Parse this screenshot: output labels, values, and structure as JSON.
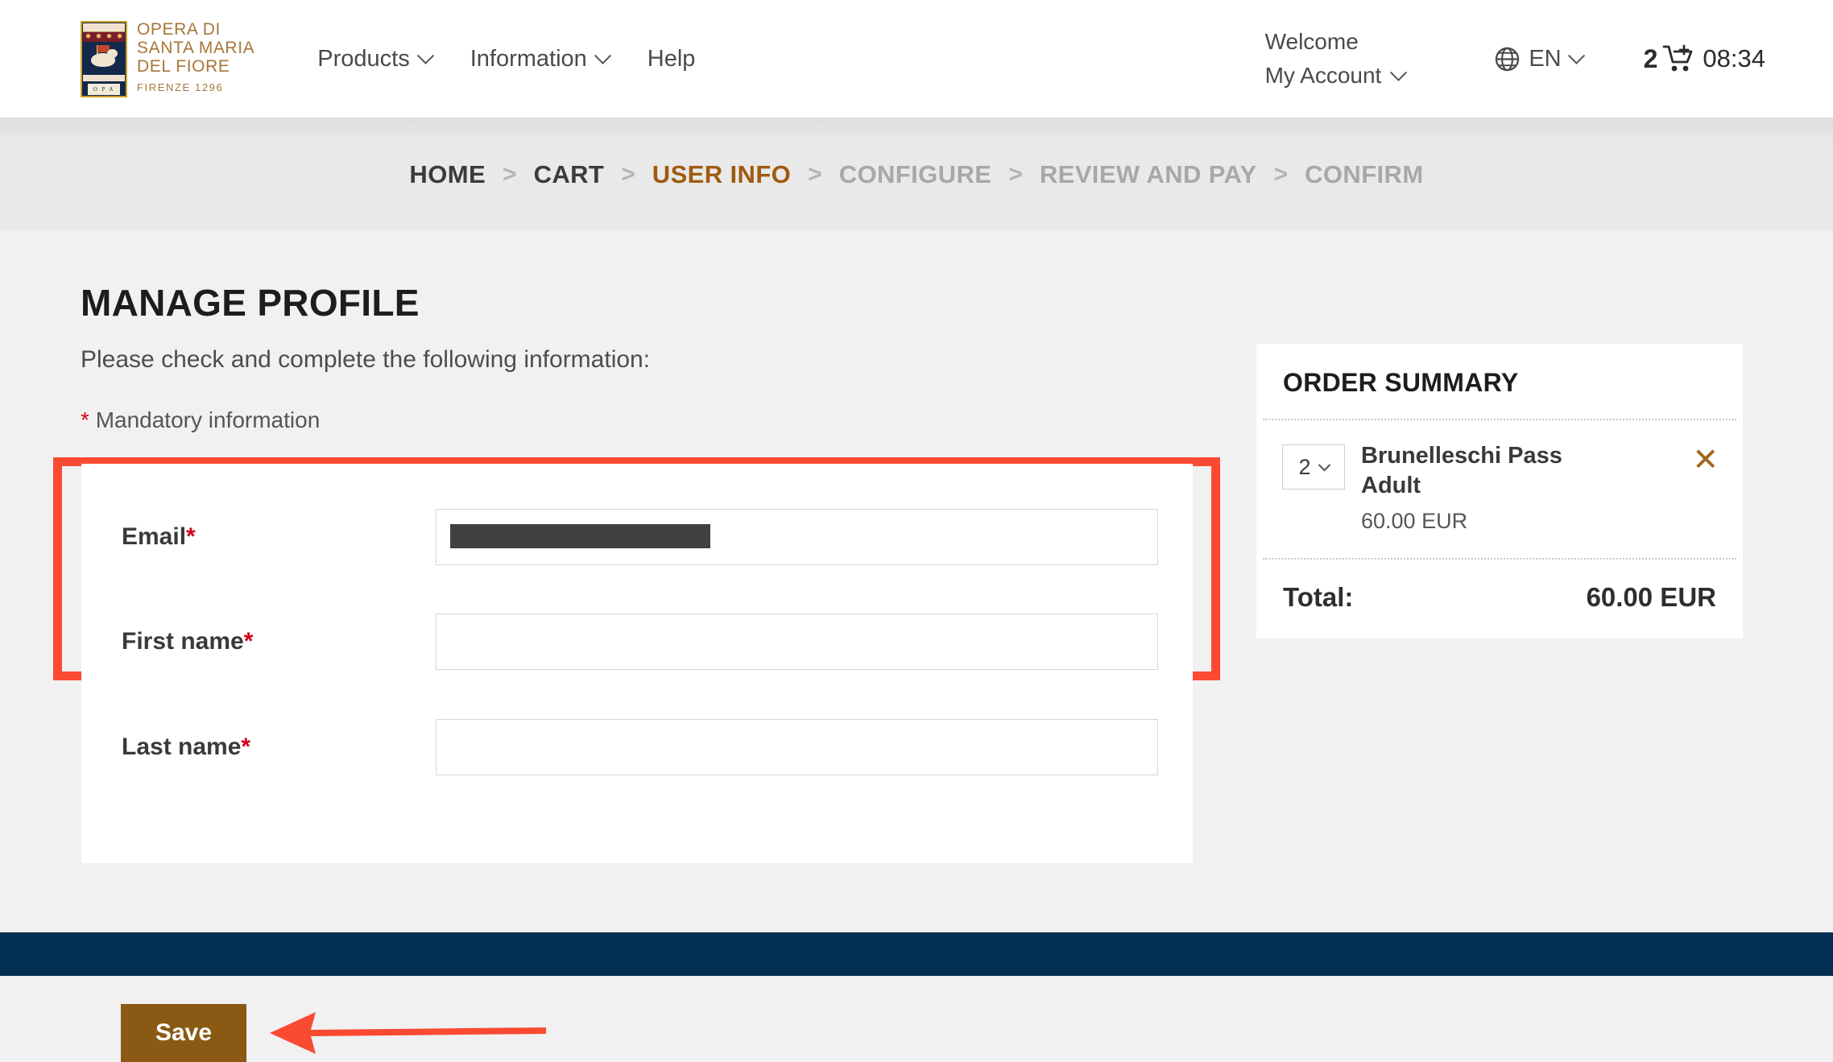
{
  "header": {
    "logo": {
      "line1": "OPERA DI",
      "line2": "SANTA MARIA",
      "line3": "DEL FIORE",
      "line4": "FIRENZE 1296",
      "crest_text": "O P A"
    },
    "nav": [
      {
        "label": "Products",
        "has_caret": true
      },
      {
        "label": "Information",
        "has_caret": true
      },
      {
        "label": "Help",
        "has_caret": false
      }
    ],
    "welcome": "Welcome",
    "account": "My Account",
    "language": "EN",
    "cart_count": "2",
    "session_time": "08:34"
  },
  "breadcrumb": [
    {
      "label": "HOME",
      "state": "done"
    },
    {
      "label": "CART",
      "state": "done"
    },
    {
      "label": "USER INFO",
      "state": "active"
    },
    {
      "label": "CONFIGURE",
      "state": "todo"
    },
    {
      "label": "REVIEW AND PAY",
      "state": "todo"
    },
    {
      "label": "CONFIRM",
      "state": "todo"
    }
  ],
  "breadcrumb_separator": ">",
  "main": {
    "title": "MANAGE PROFILE",
    "subtitle": "Please check and complete the following information:",
    "mandatory_marker": "*",
    "mandatory_note": "Mandatory information",
    "form": {
      "fields": [
        {
          "label": "Email",
          "required_marker": "*",
          "value": "",
          "redacted": true
        },
        {
          "label": "First name",
          "required_marker": "*",
          "value": "",
          "redacted": false
        },
        {
          "label": "Last name",
          "required_marker": "*",
          "value": "",
          "redacted": false
        }
      ],
      "save_label": "Save"
    }
  },
  "order_summary": {
    "title": "ORDER SUMMARY",
    "item": {
      "qty": "2",
      "name": "Brunelleschi Pass Adult",
      "price": "60.00 EUR",
      "remove_symbol": "✕"
    },
    "total_label": "Total:",
    "total_value": "60.00 EUR"
  },
  "colors": {
    "accent_brown": "#8a5a14",
    "breadcrumb_active": "#a05a10",
    "annotation_red": "#fb4a32",
    "required_red": "#d0021b",
    "footer_navy": "#032f52",
    "logo_gold": "#a8763a"
  }
}
